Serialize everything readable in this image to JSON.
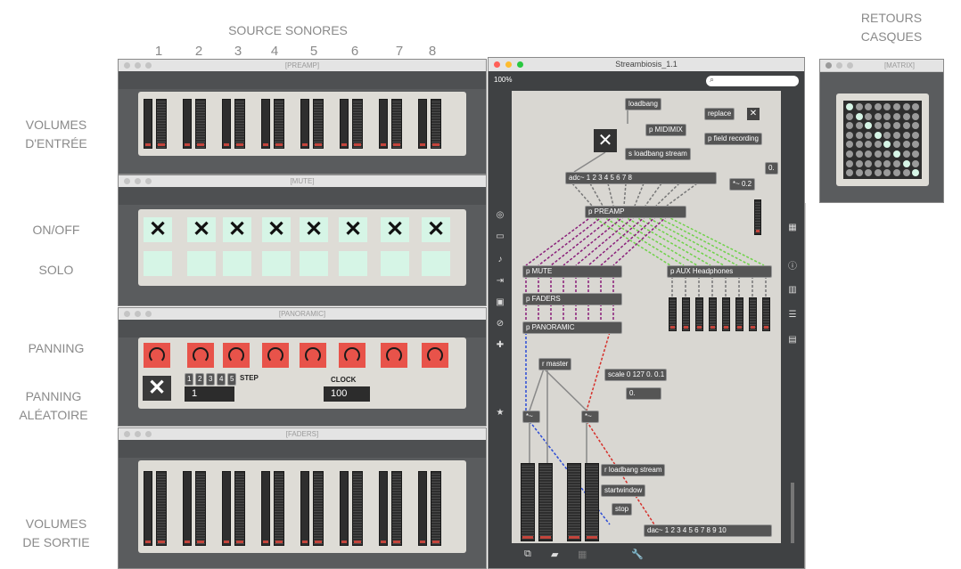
{
  "source_title": "SOURCE SONORES",
  "retours_title": "RETOURS\nCASQUES",
  "channel_numbers": [
    "1",
    "2",
    "3",
    "4",
    "5",
    "6",
    "7",
    "8"
  ],
  "row_labels": {
    "volumes_entree": "VOLUMES\nD'ENTRÉE",
    "on_off": "ON/OFF",
    "solo": "SOLO",
    "panning": "PANNING",
    "panning_aleatoire": "PANNING\nALÉATOIRE",
    "volumes_sortie": "VOLUMES\nDE SORTIE"
  },
  "windows": {
    "preamp": "[PREAMP]",
    "mute": "[MUTE]",
    "panoramic": "[PANORAMIC]",
    "faders": "[FADERS]",
    "matrix": "[MATRIX]",
    "main": "Streambiosis_1.1"
  },
  "main": {
    "zoom": "100%",
    "search_placeholder": ""
  },
  "panoramic": {
    "steps": [
      "1",
      "2",
      "3",
      "4",
      "5"
    ],
    "step_label": "STEP",
    "step_value": "1",
    "clock_label": "CLOCK",
    "clock_value": "100"
  },
  "patch_objects": {
    "loadbang": "loadbang",
    "replace": "replace",
    "midimix": "p MIDIMIX",
    "field_recording": "p field recording",
    "s_loadbang": "s loadbang stream",
    "adc": "adc~ 1 2 3 4 5 6 7 8",
    "mul02": "*~ 0.2",
    "zero": "0.",
    "preamp": "p PREAMP",
    "mute": "p MUTE",
    "aux": "p AUX Headphones",
    "faders": "p FADERS",
    "panoramic": "p PANORAMIC",
    "r_master": "r master",
    "scale": "scale 0 127 0. 0.1",
    "zero2": "0.",
    "mul_a": "*~",
    "mul_b": "*~",
    "r_loadbang": "r loadbang stream",
    "startwindow": "startwindow",
    "stop": "stop",
    "dac": "dac~ 1 2 3 4 5 6 7 8 9 10"
  },
  "colors": {
    "purple_cable": "#8a1f7a",
    "green_cable": "#6fd24a",
    "blue_cable": "#2b4bd6",
    "red_cable": "#d6302b",
    "meter_red": "#c4453c",
    "toggle_bg": "#d6f5e6",
    "knob_bg": "#e8534a"
  },
  "icons": [
    "lock-icon",
    "presentation-icon",
    "comment-icon",
    "grid-icon",
    "wrench-icon",
    "power-icon",
    "info-icon",
    "book-icon",
    "list-icon"
  ]
}
